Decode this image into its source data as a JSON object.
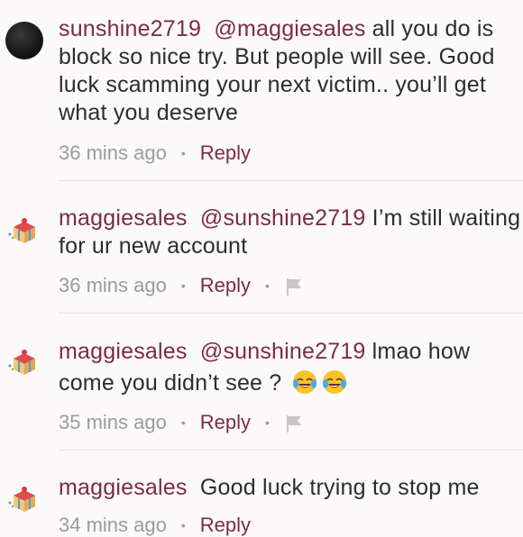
{
  "comments": [
    {
      "username": "sunshine2719",
      "mention": "@maggiesales",
      "text": " all you do is block so nice try. But people will see. Good luck scamming your next victim.. you’ll get what you deserve",
      "time": "36 mins ago",
      "reply": "Reply"
    },
    {
      "username": "maggiesales",
      "mention": "@sunshine2719",
      "text": " I’m still waiting for ur new account",
      "time": "36 mins ago",
      "reply": "Reply"
    },
    {
      "username": "maggiesales",
      "mention": "@sunshine2719",
      "text": " lmao how come you didn’t see ? ",
      "emoji_count": 2,
      "time": "35 mins ago",
      "reply": "Reply"
    },
    {
      "username": "maggiesales",
      "text": "Good luck trying to stop me",
      "time": "34 mins ago",
      "reply": "Reply"
    }
  ],
  "separator": "•",
  "icons": {
    "flag": "flag-icon",
    "emoji": "tears-of-joy-emoji",
    "avatar_box": "gift-box-avatar"
  },
  "colors": {
    "accent": "#7c2c43",
    "meta": "#9b9b9b",
    "text": "#2d2d2d"
  }
}
